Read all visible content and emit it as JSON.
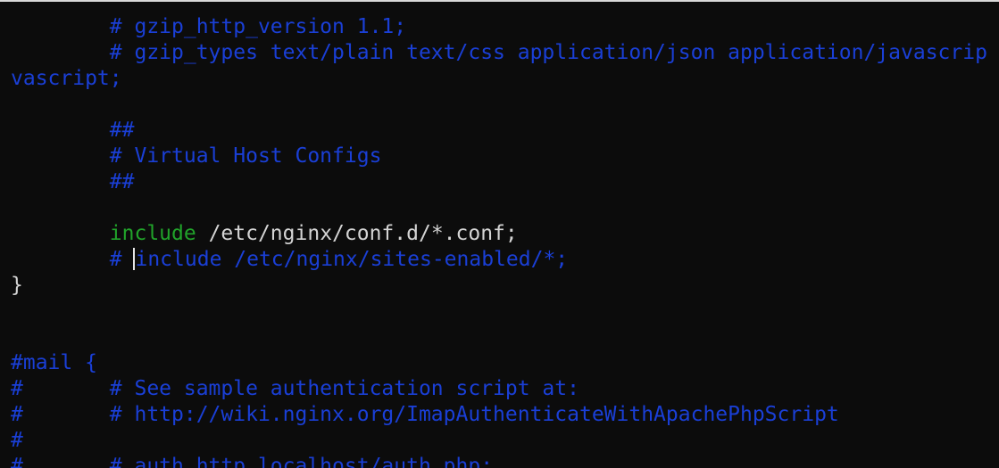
{
  "terminal": {
    "lines": [
      {
        "text": "        # gzip_http_version 1.1;"
      },
      {
        "text": "        # gzip_types text/plain text/css application/json application/javascrip"
      },
      {
        "text": "vascript;"
      },
      {
        "text": ""
      },
      {
        "text": "        ##"
      },
      {
        "text": "        # Virtual Host Configs"
      },
      {
        "text": "        ##"
      },
      {
        "text": ""
      },
      {
        "indent": "        ",
        "keyword": "include",
        "rest": " /etc/nginx/conf.d/*.conf;"
      },
      {
        "before_cursor": "        # ",
        "after_cursor": "include /etc/nginx/sites-enabled/*;"
      },
      {
        "text": "}"
      },
      {
        "text": ""
      },
      {
        "text": ""
      },
      {
        "text": "#mail {"
      },
      {
        "text": "#       # See sample authentication script at:"
      },
      {
        "text": "#       # http://wiki.nginx.org/ImapAuthenticateWithApachePhpScript"
      },
      {
        "text": "#"
      },
      {
        "text": "#       # auth_http localhost/auth.php;"
      }
    ]
  },
  "colors": {
    "background": "#0c0c0c",
    "comment": "#1a3fd6",
    "keyword": "#21a32a",
    "plain_text": "#d4d4d4",
    "cursor": "#e6e6e6"
  }
}
